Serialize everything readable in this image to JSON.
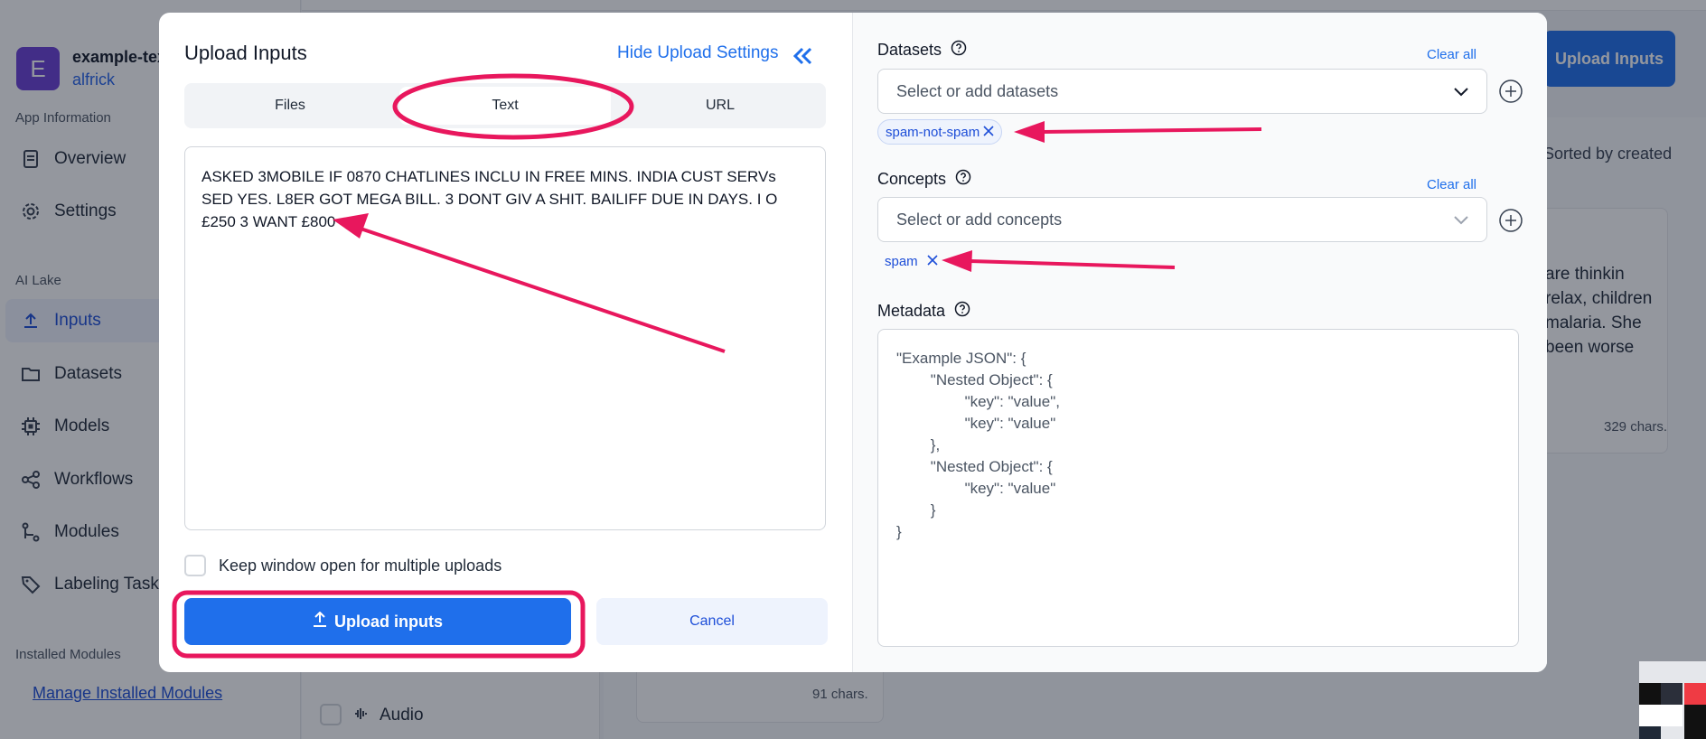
{
  "sidebar": {
    "app_initial": "E",
    "app_name": "example-tex",
    "app_user": "alfrick",
    "section_app_info": "App Information",
    "overview": "Overview",
    "settings": "Settings",
    "section_ai_lake": "AI Lake",
    "inputs": "Inputs",
    "datasets": "Datasets",
    "models": "Models",
    "workflows": "Workflows",
    "modules": "Modules",
    "labeling_tasks": "Labeling Tasks",
    "section_installed": "Installed Modules",
    "manage_installed": "Manage Installed Modules"
  },
  "background": {
    "upload_inputs_button": "Upload Inputs",
    "sorted_label": "Sorted by created",
    "card_text_lines": [
      "are thinkin",
      "relax, children",
      "malaria. She",
      "been worse"
    ],
    "card_chars": "329 chars.",
    "card2_chars": "91 chars.",
    "filter_audio": "Audio"
  },
  "modal": {
    "title": "Upload Inputs",
    "hide_settings": "Hide Upload Settings",
    "tabs": [
      "Files",
      "Text",
      "URL"
    ],
    "active_tab": "Text",
    "text_value": "ASKED 3MOBILE IF 0870 CHATLINES INCLU IN FREE MINS. INDIA CUST SERVs SED YES. L8ER GOT MEGA BILL. 3 DONT GIV A SHIT. BAILIFF DUE IN DAYS. I O £250 3 WANT £800",
    "keep_open_label": "Keep window open for multiple uploads",
    "upload_button": "Upload inputs",
    "cancel_button": "Cancel",
    "datasets": {
      "label": "Datasets",
      "clear_all": "Clear all",
      "placeholder": "Select or add datasets",
      "chips": [
        "spam-not-spam"
      ]
    },
    "concepts": {
      "label": "Concepts",
      "clear_all": "Clear all",
      "placeholder": "Select or add concepts",
      "chips": [
        "spam"
      ]
    },
    "metadata": {
      "label": "Metadata",
      "placeholder": "\"Example JSON\": {\n        \"Nested Object\": {\n                \"key\": \"value\",\n                \"key\": \"value\"\n        },\n        \"Nested Object\": {\n                \"key\": \"value\"\n        }\n}"
    }
  },
  "colors": {
    "primary": "#1f6feb",
    "annotation": "#e8175d",
    "app_avatar": "#6a3fd6"
  }
}
